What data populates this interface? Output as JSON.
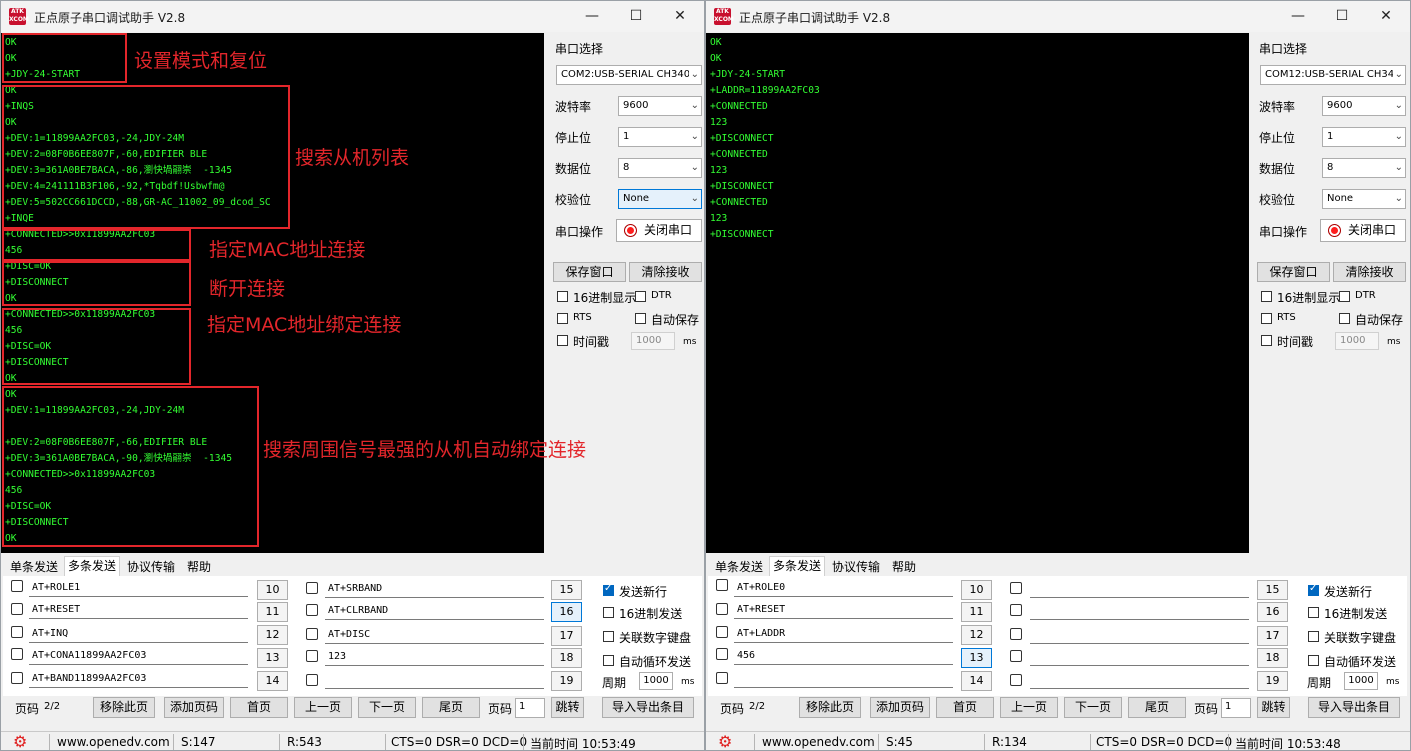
{
  "left": {
    "title": "正点原子串口调试助手 V2.8",
    "icon_text": "ATK\nXCOM",
    "terminal_lines": [
      "OK",
      "OK",
      "+JDY-24-START",
      "OK",
      "+INQS",
      "OK",
      "+DEV:1=11899AA2FC03,-24,JDY-24M",
      "+DEV:2=08F0B6EE807F,-60,EDIFIER BLE",
      "+DEV:3=361A0BE7BACA,-86,瀏快堝翮崇  -1345",
      "+DEV:4=241111B3F106,-92,*Tqbdf!Usbwfm@",
      "+DEV:5=502CC661DCCD,-88,GR-AC_11002_09_dcod_SC",
      "+INQE",
      "+CONNECTED>>0x11899AA2FC03",
      "456",
      "+DISC=OK",
      "+DISCONNECT",
      "OK",
      "+CONNECTED>>0x11899AA2FC03",
      "456",
      "+DISC=OK",
      "+DISCONNECT",
      "OK",
      "OK",
      "+DEV:1=11899AA2FC03,-24,JDY-24M",
      "",
      "+DEV:2=08F0B6EE807F,-66,EDIFIER BLE",
      "+DEV:3=361A0BE7BACA,-90,瀏快堝翮崇  -1345",
      "+CONNECTED>>0x11899AA2FC03",
      "456",
      "+DISC=OK",
      "+DISCONNECT",
      "OK"
    ],
    "annotations": [
      "设置模式和复位",
      "搜索从机列表",
      "指定MAC地址连接",
      "断开连接",
      "指定MAC地址绑定连接",
      "搜索周围信号最强的从机自动绑定连接"
    ],
    "port_value": "COM2:USB-SERIAL CH340",
    "cmds_left": [
      "AT+ROLE1",
      "AT+RESET",
      "AT+INQ",
      "AT+CONA11899AA2FC03",
      "AT+BAND11899AA2FC03"
    ],
    "cmds_right": [
      "AT+SRBAND",
      "AT+CLRBAND",
      "AT+DISC",
      "123",
      ""
    ],
    "status": {
      "s": "S:147",
      "r": "R:543",
      "time": "当前时间 10:53:49"
    }
  },
  "right": {
    "title": "正点原子串口调试助手 V2.8",
    "icon_text": "ATK\nXCOM",
    "terminal_lines": [
      "OK",
      "OK",
      "+JDY-24-START",
      "+LADDR=11899AA2FC03",
      "+CONNECTED",
      "123",
      "+DISCONNECT",
      "+CONNECTED",
      "123",
      "+DISCONNECT",
      "+CONNECTED",
      "123",
      "+DISCONNECT"
    ],
    "port_value": "COM12:USB-SERIAL CH340",
    "cmds_left": [
      "AT+ROLE0",
      "AT+RESET",
      "AT+LADDR",
      "456",
      ""
    ],
    "cmds_right": [
      "",
      "",
      "",
      "",
      ""
    ],
    "status": {
      "s": "S:45",
      "r": "R:134",
      "time": "当前时间 10:53:48"
    }
  },
  "common": {
    "labels": {
      "port_select": "串口选择",
      "baud": "波特率",
      "stop": "停止位",
      "data": "数据位",
      "parity": "校验位",
      "port_op": "串口操作"
    },
    "values": {
      "baud": "9600",
      "stop": "1",
      "data": "8",
      "parity": "None"
    },
    "close_port": "关闭串口",
    "save_window": "保存窗口",
    "clear_recv": "清除接收",
    "hex_display": "16进制显示",
    "dtr": "DTR",
    "rts": "RTS",
    "auto_save": "自动保存",
    "timestamp": "时间戳",
    "timestamp_value": "1000",
    "ms": "ms",
    "tabs": [
      "单条发送",
      "多条发送",
      "协议传输",
      "帮助"
    ],
    "nums_left": [
      "10",
      "11",
      "12",
      "13",
      "14"
    ],
    "nums_right": [
      "15",
      "16",
      "17",
      "18",
      "19"
    ],
    "send_newline": "发送新行",
    "hex_send": "16进制发送",
    "link_keypad": "关联数字键盘",
    "auto_loop": "自动循环发送",
    "period": "周期",
    "period_value": "1000",
    "page_label": "页码",
    "page_value": "2/2",
    "remove_page": "移除此页",
    "add_page": "添加页码",
    "first_page": "首页",
    "prev_page": "上一页",
    "next_page": "下一页",
    "last_page": "尾页",
    "page_input": "1",
    "jump": "跳转",
    "import_export": "导入导出条目",
    "website": "www.openedv.com",
    "modem": "CTS=0 DSR=0 DCD=0",
    "colors": {
      "terminal_bg": "#000000",
      "terminal_text": "#33ff33",
      "annotation": "#e3262b"
    }
  }
}
